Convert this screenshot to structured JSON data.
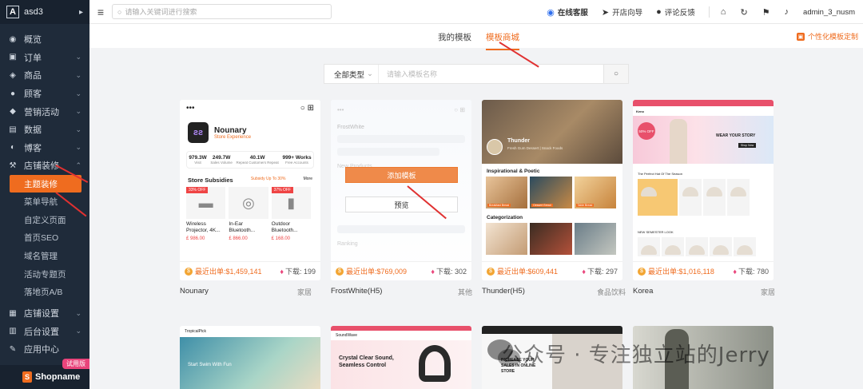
{
  "sidebar": {
    "logo": "A",
    "store": "asd3",
    "caret": "▸",
    "menu": [
      {
        "icon": "◉",
        "label": "概览",
        "chevron": ""
      },
      {
        "icon": "▣",
        "label": "订单",
        "chevron": "⌄"
      },
      {
        "icon": "◈",
        "label": "商品",
        "chevron": "⌄"
      },
      {
        "icon": "●",
        "label": "顾客",
        "chevron": "⌄"
      },
      {
        "icon": "◆",
        "label": "营销活动",
        "chevron": "⌄"
      },
      {
        "icon": "▤",
        "label": "数据",
        "chevron": "⌄"
      },
      {
        "icon": "◐",
        "label": "博客",
        "chevron": "⌄"
      },
      {
        "icon": "⚒",
        "label": "店铺装修",
        "chevron": "⌃"
      }
    ],
    "submenu": [
      "主题装修",
      "菜单导航",
      "自定义页面",
      "首页SEO",
      "域名管理",
      "活动专题页",
      "落地页A/B"
    ],
    "menu2": [
      {
        "icon": "▦",
        "label": "店铺设置",
        "chevron": "⌄"
      },
      {
        "icon": "▥",
        "label": "后台设置",
        "chevron": "⌄"
      },
      {
        "icon": "✎",
        "label": "应用中心",
        "chevron": ""
      }
    ],
    "brand": "Shopname",
    "trial": "试用版"
  },
  "topbar": {
    "search_placeholder": "请输入关键词进行搜索",
    "service": "在线客服",
    "guide": "开店向导",
    "feedback": "评论反馈",
    "user": "admin_3_nusm"
  },
  "tabs": {
    "mine": "我的模板",
    "mall": "模板商城"
  },
  "custom_link": "个性化模板定制",
  "filter": {
    "type": "全部类型",
    "placeholder": "请输入模板名称"
  },
  "cards": [
    {
      "name": "Nounary",
      "category": "家居",
      "sales": "最近出单:$1,459,141",
      "downloads": "下载: 199"
    },
    {
      "name": "FrostWhite(H5)",
      "category": "其他",
      "sales": "最近出单:$769,009",
      "downloads": "下载: 302"
    },
    {
      "name": "Thunder(H5)",
      "category": "食品饮料",
      "sales": "最近出单:$609,441",
      "downloads": "下载: 297"
    },
    {
      "name": "Korea",
      "category": "家居",
      "sales": "最近出单:$1,016,118",
      "downloads": "下载: 780"
    }
  ],
  "overlay": {
    "add": "添加模板",
    "preview": "预览"
  },
  "nounary": {
    "title": "Nounary",
    "subtitle": "Store Experience",
    "stats": [
      {
        "v": "979.3W",
        "k": "Visit"
      },
      {
        "v": "249.7W",
        "k": "Sales Volume"
      },
      {
        "v": "40.1W",
        "k": "Repeat Customers Repeat"
      },
      {
        "v": "999+ Works",
        "k": "Free Accounts"
      }
    ],
    "subsidy": "Store Subsidies",
    "subsidy_note": "Subsidy Up To 30%",
    "more": "More",
    "products": [
      {
        "badge": "33% OFF",
        "name": "Wireless Projector, 4K...",
        "price": "£ 986.00"
      },
      {
        "badge": "",
        "name": "In-Ear Bluetooth...",
        "price": "£ 866.00"
      },
      {
        "badge": "37% OFF",
        "name": "Outdoor Bluetooth...",
        "price": "£ 168.00"
      }
    ]
  },
  "frost": {
    "brand": "FrostWhite",
    "new": "New Products",
    "ranking": "Ranking"
  },
  "thunder": {
    "name": "Thunder",
    "tagline": "Fresh Gum Dessert | Snack Foods",
    "sec1": "Inspirational & Poetic",
    "sec2": "Categorization",
    "tags": [
      "Breakfast Bread",
      "Dessert Bread",
      "Table Bread"
    ]
  },
  "korea": {
    "logo": "Keno",
    "badge": "50% OFF",
    "wear": "WEAR YOUR STORY",
    "shop": "Shop Now",
    "section": "The Perfect Hat Of The Season",
    "section2": "NEW SEMESTER LOOK"
  },
  "bottom": [
    {
      "hero": "Start Swim With Fun",
      "logo": "TropicalPick"
    },
    {
      "hero": "Crystal Clear Sound, Seamless Control",
      "logo": "SoundWave"
    },
    {
      "hero": "INCREASE YOUR SALES IN ONLINE STORE",
      "logo": ""
    },
    {
      "hero": "",
      "logo": ""
    }
  ],
  "watermark": "公众号 · 专注独立站的Jerry"
}
